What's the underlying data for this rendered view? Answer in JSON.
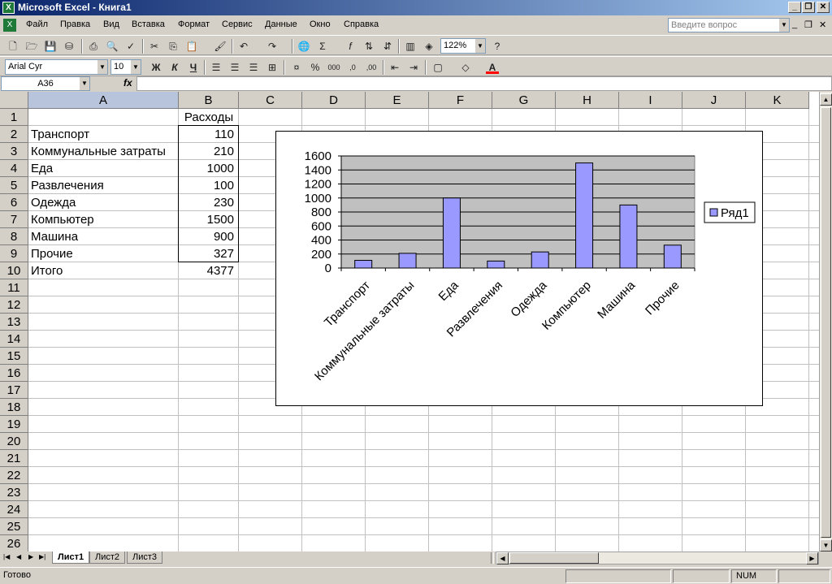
{
  "window": {
    "title": "Microsoft Excel - Книга1"
  },
  "menu": {
    "items": [
      "Файл",
      "Правка",
      "Вид",
      "Вставка",
      "Формат",
      "Сервис",
      "Данные",
      "Окно",
      "Справка"
    ],
    "ask_placeholder": "Введите вопрос"
  },
  "toolbar": {
    "zoom": "122%",
    "font": "Arial Cyr",
    "size": "10",
    "bold": "Ж",
    "italic": "К",
    "underline": "Ч"
  },
  "formula_bar": {
    "name_box": "A36",
    "fx": "fx",
    "content": ""
  },
  "columns": [
    "A",
    "B",
    "C",
    "D",
    "E",
    "F",
    "G",
    "H",
    "I",
    "J",
    "K"
  ],
  "rows": [
    "1",
    "2",
    "3",
    "4",
    "5",
    "6",
    "7",
    "8",
    "9",
    "10",
    "11",
    "12",
    "13",
    "14",
    "15",
    "16",
    "17",
    "18",
    "19",
    "20",
    "21",
    "22",
    "23",
    "24",
    "25",
    "26"
  ],
  "table": {
    "header": "Расходы",
    "rows": [
      {
        "label": "Транспорт",
        "value": "110"
      },
      {
        "label": "Коммунальные затраты",
        "value": "210"
      },
      {
        "label": "Еда",
        "value": "1000"
      },
      {
        "label": "Развлечения",
        "value": "100"
      },
      {
        "label": "Одежда",
        "value": "230"
      },
      {
        "label": "Компьютер",
        "value": "1500"
      },
      {
        "label": "Машина",
        "value": "900"
      },
      {
        "label": "Прочие",
        "value": "327"
      }
    ],
    "total_label": "Итого",
    "total_value": "4377"
  },
  "chart_data": {
    "type": "bar",
    "categories": [
      "Транспорт",
      "Коммунальные затраты",
      "Еда",
      "Развлечения",
      "Одежда",
      "Компьютер",
      "Машина",
      "Прочие"
    ],
    "series": [
      {
        "name": "Ряд1",
        "values": [
          110,
          210,
          1000,
          100,
          230,
          1500,
          900,
          327
        ],
        "color": "#9999ff"
      }
    ],
    "yticks": [
      0,
      200,
      400,
      600,
      800,
      1000,
      1200,
      1400,
      1600
    ],
    "ylim": [
      0,
      1600
    ],
    "grid": true,
    "plot_background": "#c0c0c0",
    "legend": "right",
    "title": "",
    "xlabel": "",
    "ylabel": ""
  },
  "sheets": {
    "tabs": [
      "Лист1",
      "Лист2",
      "Лист3"
    ],
    "active": "Лист1"
  },
  "status": {
    "ready": "Готово",
    "num": "NUM"
  }
}
